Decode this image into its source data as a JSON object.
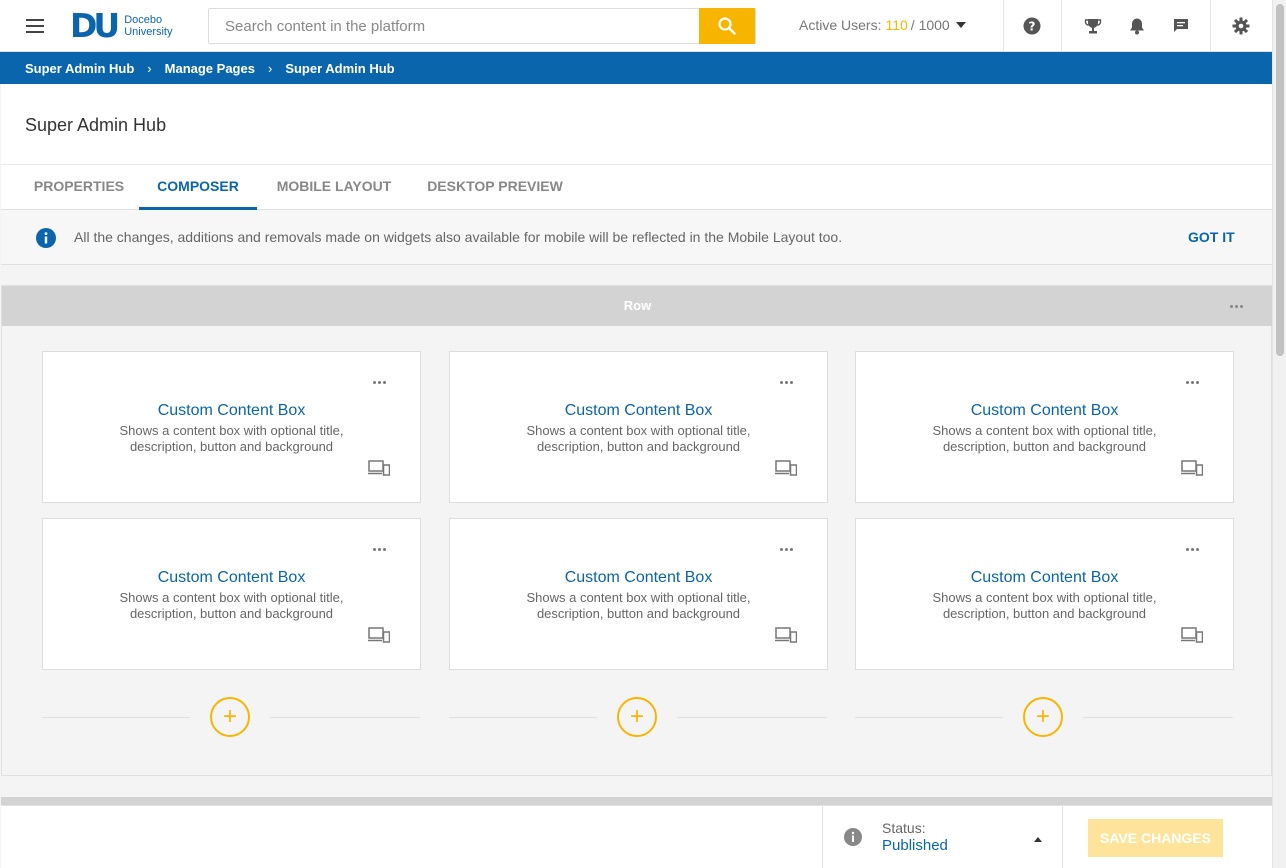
{
  "header": {
    "logo_mark": "DU",
    "logo_line1": "Docebo",
    "logo_line2": "University",
    "search_placeholder": "Search content in the platform",
    "active_users_label": "Active Users:",
    "active_users_count": "110",
    "active_users_total": "/ 1000",
    "accent_color": "#f7b500",
    "icons": [
      "menu-icon",
      "search-icon",
      "help-icon",
      "trophy-icon",
      "bell-icon",
      "chat-icon",
      "gear-icon"
    ]
  },
  "breadcrumb": [
    "Super Admin Hub",
    "Manage Pages",
    "Super Admin Hub"
  ],
  "page": {
    "title": "Super Admin Hub",
    "tabs": [
      {
        "label": "PROPERTIES",
        "active": false
      },
      {
        "label": "COMPOSER",
        "active": true
      },
      {
        "label": "MOBILE LAYOUT",
        "active": false
      },
      {
        "label": "DESKTOP PREVIEW",
        "active": false
      }
    ]
  },
  "info": {
    "text": "All the changes, additions and removals made on widgets also available for mobile will be reflected in the Mobile Layout too.",
    "action": "GOT IT"
  },
  "row": {
    "label": "Row",
    "widgets": [
      {
        "title": "Custom Content Box",
        "description": "Shows a content box with optional title, description, button and background"
      },
      {
        "title": "Custom Content Box",
        "description": "Shows a content box with optional title, description, button and background"
      },
      {
        "title": "Custom Content Box",
        "description": "Shows a content box with optional title, description, button and background"
      },
      {
        "title": "Custom Content Box",
        "description": "Shows a content box with optional title, description, button and background"
      },
      {
        "title": "Custom Content Box",
        "description": "Shows a content box with optional title, description, button and background"
      },
      {
        "title": "Custom Content Box",
        "description": "Shows a content box with optional title, description, button and background"
      }
    ],
    "add_symbol": "+"
  },
  "footer": {
    "status_label": "Status:",
    "status_value": "Published",
    "save_label": "SAVE CHANGES"
  },
  "colors": {
    "primary": "#0a65ad",
    "accent": "#f7b500"
  }
}
